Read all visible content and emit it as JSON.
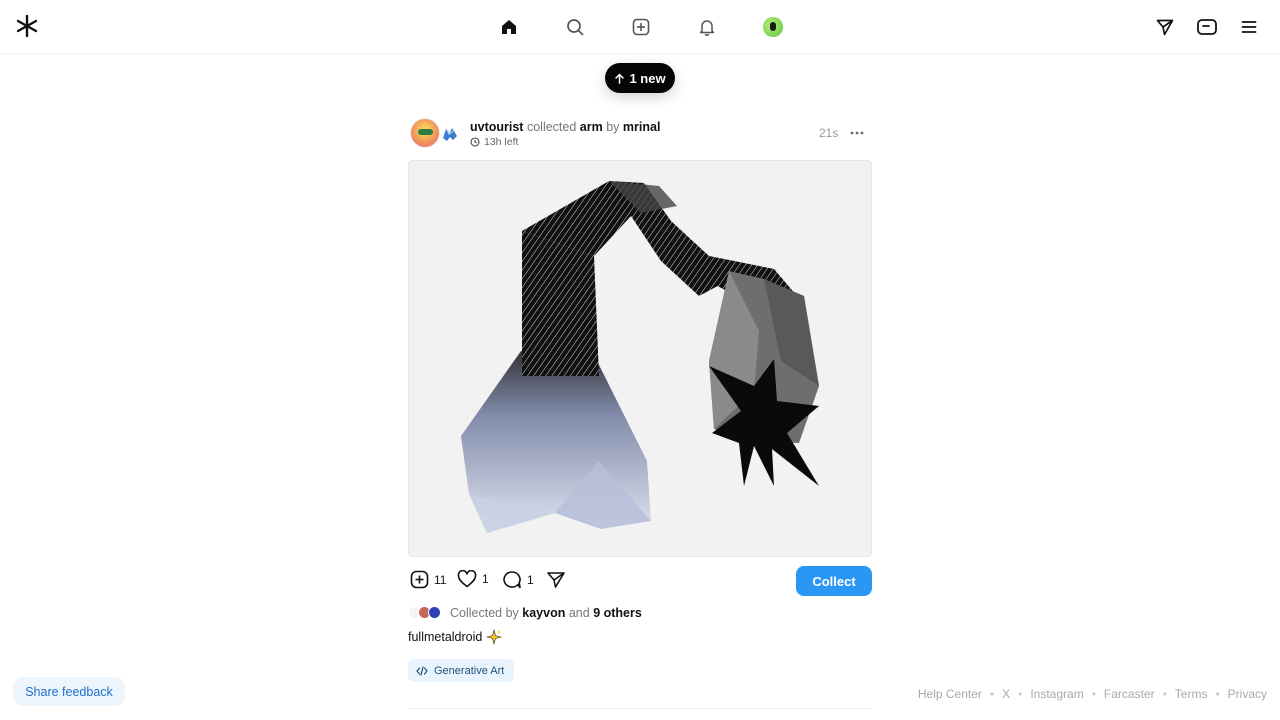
{
  "topbar": {
    "nav_icons": [
      "home-icon",
      "search-icon",
      "add-square-icon",
      "bell-icon",
      "profile-avatar"
    ],
    "right_icons": [
      "send-icon",
      "wallet-icon",
      "menu-icon"
    ]
  },
  "new_pill": {
    "label": "1 new"
  },
  "post": {
    "actor": "uvtourist",
    "verb": "collected",
    "title": "arm",
    "connector": "by",
    "artist": "mrinal",
    "time_left": "13h left",
    "timestamp": "21s",
    "stats": {
      "collects": "11",
      "likes": "1",
      "comments": "1"
    },
    "collect_label": "Collect",
    "collected_by_prefix": "Collected by",
    "collected_by_user": "kayvon",
    "collected_by_and": "and",
    "collected_by_others": "9 others",
    "caption": "fullmetaldroid",
    "caption_emoji": "sparkles-icon",
    "tag": "Generative Art"
  },
  "feedback": {
    "label": "Share feedback"
  },
  "footer": {
    "links": [
      "Help Center",
      "X",
      "Instagram",
      "Farcaster",
      "Terms",
      "Privacy"
    ]
  },
  "colors": {
    "accent": "#2b97f5",
    "pill": "#050505",
    "tag_bg": "#e9f4fe"
  }
}
